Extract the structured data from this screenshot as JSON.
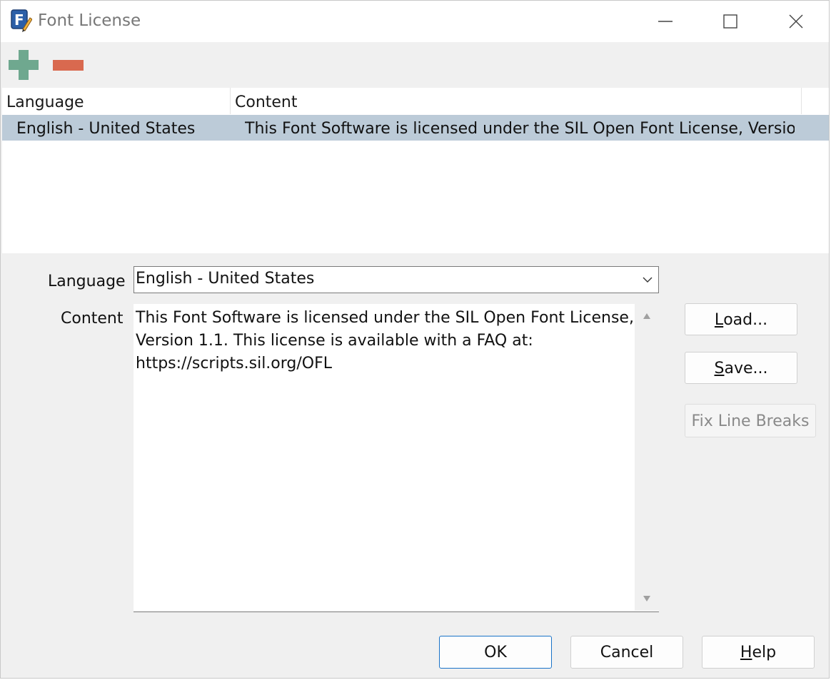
{
  "window": {
    "title": "Font License",
    "icon": "fontforge-app-icon",
    "controls": [
      "minimize",
      "maximize",
      "close"
    ]
  },
  "toolbar": {
    "add_icon": "plus-icon",
    "remove_icon": "minus-icon",
    "add_color": "#6fa88f",
    "remove_color": "#d9694f"
  },
  "list": {
    "columns": [
      "Language",
      "Content"
    ],
    "rows": [
      {
        "language": "English - United States",
        "content": "This Font Software is licensed under the SIL Open Font License, Versio..."
      }
    ],
    "selected_row_color": "#bccbd8"
  },
  "form": {
    "language_label": "Language",
    "language_value": "English - United States",
    "content_label": "Content",
    "content_lines": [
      "This Font Software is licensed under the SIL Open Font License,",
      "Version 1.1. This license is available with a FAQ at:",
      "https://scripts.sil.org/OFL"
    ]
  },
  "side_buttons": {
    "load_accel": "L",
    "load_rest": "oad...",
    "save_accel": "S",
    "save_rest": "ave...",
    "fix_line_breaks": "Fix Line Breaks"
  },
  "footer": {
    "ok": "OK",
    "cancel": "Cancel",
    "help_accel": "H",
    "help_rest": "elp"
  }
}
